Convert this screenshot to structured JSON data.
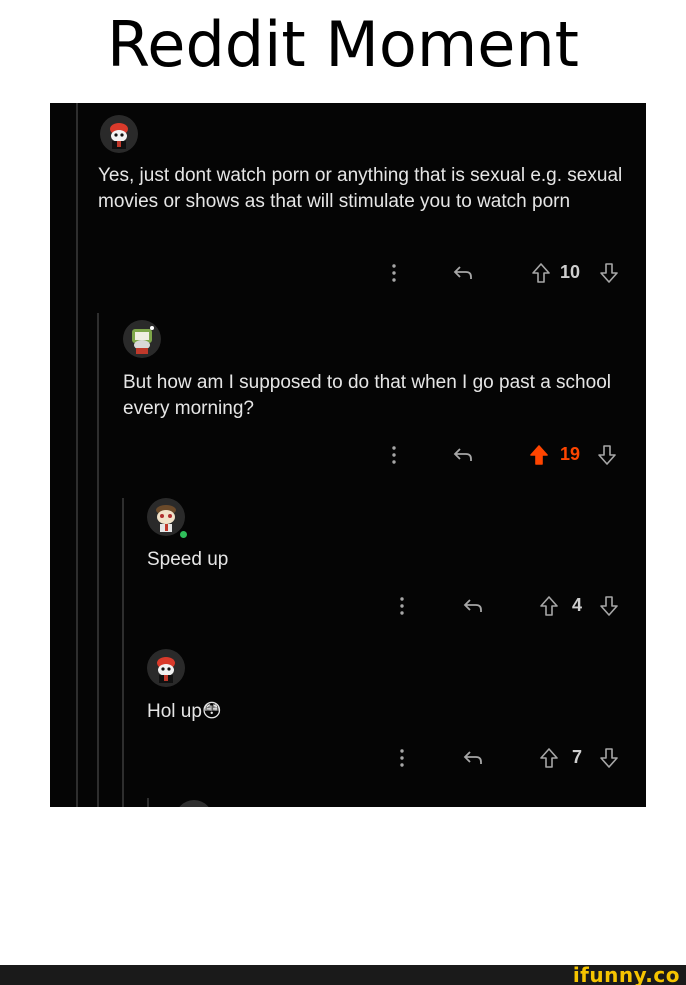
{
  "meme_title": "Reddit Moment",
  "comments": [
    {
      "text": "Yes, just dont watch porn or anything that is sexual e.g. sexual movies or shows as that will stimulate you to watch porn",
      "score": "10"
    },
    {
      "text": "But how am I supposed to do that when I go past a school every morning?",
      "score": "19"
    },
    {
      "text": "Speed up",
      "score": "4"
    },
    {
      "text": "Hol up",
      "emoji": "😳",
      "score": "7"
    }
  ],
  "icons": {
    "more": "more-vertical-icon",
    "reply": "reply-icon",
    "upvote": "upvote-arrow-icon",
    "downvote": "downvote-arrow-icon"
  },
  "colors": {
    "background": "#050505",
    "text": "#e6e6e6",
    "upvoted": "#ff4500",
    "online": "#2fbf5a",
    "brand": "#f5c400"
  },
  "watermark": "ifunny.co"
}
